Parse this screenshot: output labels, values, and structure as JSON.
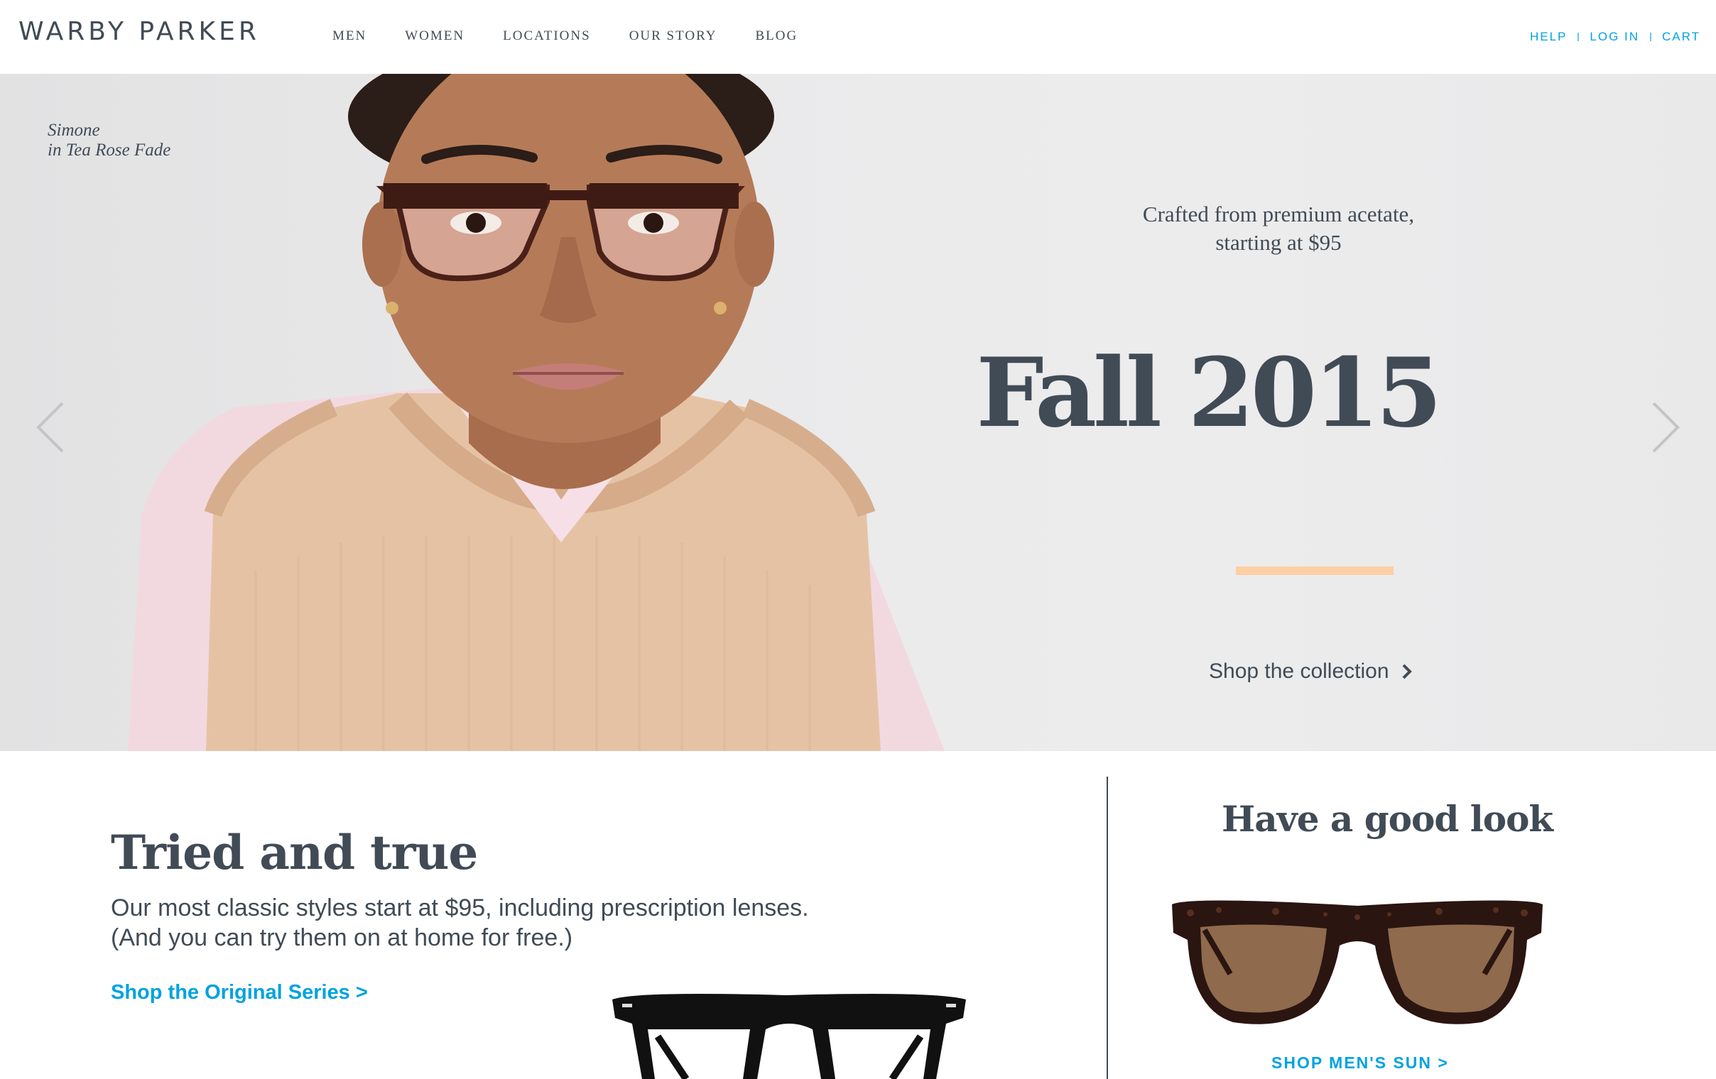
{
  "header": {
    "logo": "WARBY PARKER",
    "nav": [
      "MEN",
      "WOMEN",
      "LOCATIONS",
      "OUR STORY",
      "BLOG"
    ],
    "utility": [
      "HELP",
      "LOG IN",
      "CART"
    ]
  },
  "hero": {
    "caption_name": "Simone",
    "caption_frame": "in Tea Rose Fade",
    "subtitle_line1": "Crafted from premium acetate,",
    "subtitle_line2": "starting at $95",
    "title": "Fall 2015",
    "cta": "Shop the collection",
    "accent_color": "#fdcfa4"
  },
  "tried": {
    "title": "Tried and true",
    "body_line1": "Our most classic styles start at $95, including prescription lenses.",
    "body_line2": "(And you can try them on at home for free.)",
    "link": "Shop the Original Series >"
  },
  "good_look": {
    "title": "Have a good look",
    "link": "SHOP MEN'S SUN >"
  },
  "colors": {
    "text": "#414b56",
    "link": "#00a2e1"
  },
  "icons": [
    "chevron-left-icon",
    "chevron-right-icon",
    "chevron-right-small-icon"
  ]
}
